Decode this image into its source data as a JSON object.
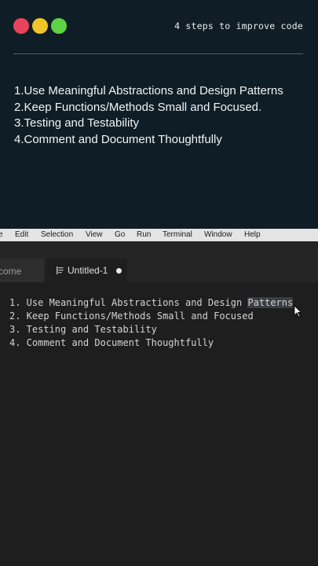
{
  "slide": {
    "title": "4 steps to improve code",
    "window_controls": [
      {
        "name": "close",
        "color": "#e9435a"
      },
      {
        "name": "minimize",
        "color": "#f0c52a"
      },
      {
        "name": "maximize",
        "color": "#5ed245"
      }
    ],
    "items": [
      "1.Use Meaningful Abstractions and Design Patterns",
      "2.Keep Functions/Methods Small and Focused.",
      "3.Testing and Testability",
      "4.Comment and Document Thoughtfully"
    ]
  },
  "menubar": {
    "items": [
      "e",
      "Edit",
      "Selection",
      "View",
      "Go",
      "Run",
      "Terminal",
      "Window",
      "Help"
    ]
  },
  "tabs": {
    "welcome_label": "come",
    "active_label": "Untitled-1"
  },
  "editor": {
    "lines": [
      {
        "number": "1.",
        "before": " Use Meaningful Abstractions and Design ",
        "highlight": "Patterns"
      },
      {
        "number": "2.",
        "before": " Keep Functions/Methods Small and Focused",
        "highlight": ""
      },
      {
        "number": "3.",
        "before": " Testing and Testability",
        "highlight": ""
      },
      {
        "number": "4.",
        "before": " Comment and Document Thoughtfully",
        "highlight": ""
      }
    ]
  },
  "colors": {
    "slide_bg": "#0f1e26",
    "editor_bg": "#1e1e1e",
    "selection_highlight": "#3a3d41"
  }
}
